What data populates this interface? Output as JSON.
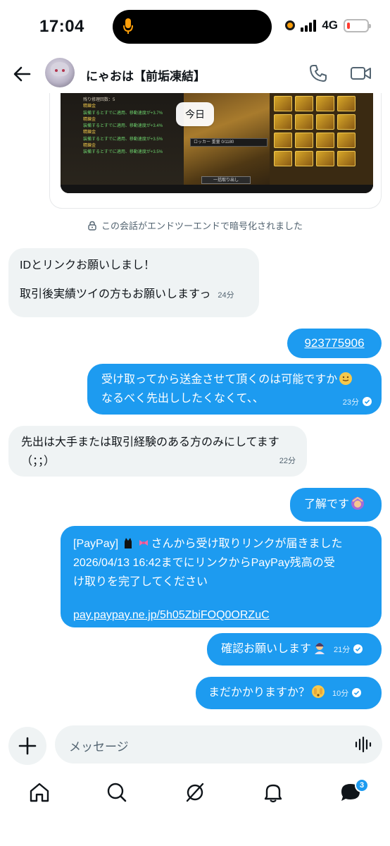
{
  "status_bar": {
    "time": "17:04",
    "network": "4G",
    "battery_level": 0.15
  },
  "header": {
    "contact_name": "にゃおは【前垢凍結】"
  },
  "media": {
    "locker_label": "ロッカー 重量 0/1180",
    "button_label": "一括取り出し",
    "repair_line": "残り修理回数：5",
    "stat_lines": [
      "精錬金",
      "装備するとすでに適用、移動速度が+3.7%",
      "精錬金",
      "装備するとすでに適用、移動速度が+3.4%",
      "精錬金",
      "装備するとすでに適用、移動速度が+3.5%",
      "精錬金",
      "装備するとすでに適用、移動速度が+3.5%"
    ]
  },
  "date_pill": "今日",
  "encryption_notice": "この会話がエンドツーエンドで暗号化されました",
  "messages": [
    {
      "side": "in",
      "lines": [
        "IDとリンクお願いしまし！",
        "",
        "取引後実績ツイの方もお願いしますっ"
      ],
      "time": "24分"
    },
    {
      "side": "out",
      "text": "923775906",
      "link": true
    },
    {
      "side": "out",
      "lines": [
        "受け取ってから送金させて頂くのは可能ですか",
        "なるべく先出ししたくなくて、、"
      ],
      "emoji": "sweat-smile-emoji",
      "time": "23分"
    },
    {
      "side": "in",
      "lines": [
        "先出は大手または取引経験のある方のみにしてます",
        "（；；）"
      ],
      "time": "22分"
    },
    {
      "side": "out",
      "text": "了解です",
      "emoji": "person-gesturing-ok-emoji"
    },
    {
      "side": "out",
      "lines": [
        "[PayPay] ",
        "さんから受け取りリンクが届きました",
        "2026/04/13 16:42までにリンクからPayPay残高の受",
        "け取りを完了してください",
        "",
        "pay.paypay.ne.jp/5h05ZbiFOQ0ORZuC"
      ],
      "emoji": "cat-and-ribbon-emoji"
    },
    {
      "side": "out",
      "text": "確認お願いします",
      "emoji": "bowing-person-emoji",
      "time": "21分"
    },
    {
      "side": "out",
      "text": "まだかかりますか？",
      "emoji": "peeking-face-emoji",
      "time": "10分"
    }
  ],
  "composer": {
    "placeholder": "メッセージ"
  },
  "nav": {
    "messages_badge": "3"
  },
  "colors": {
    "accent": "#1d9bf0",
    "incoming_bg": "#eff3f4",
    "text": "#0f1419",
    "muted": "#536471"
  }
}
